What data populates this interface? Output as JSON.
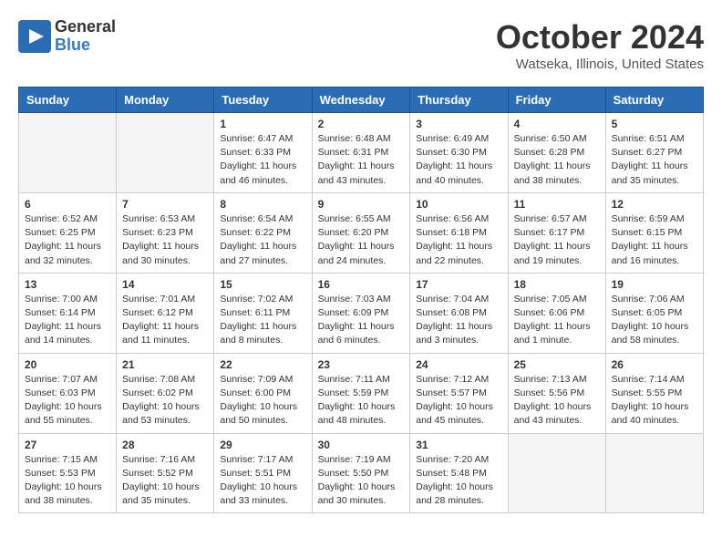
{
  "logo": {
    "general": "General",
    "blue": "Blue"
  },
  "title": "October 2024",
  "location": "Watseka, Illinois, United States",
  "days_of_week": [
    "Sunday",
    "Monday",
    "Tuesday",
    "Wednesday",
    "Thursday",
    "Friday",
    "Saturday"
  ],
  "weeks": [
    [
      {
        "day": "",
        "sunrise": "",
        "sunset": "",
        "daylight": "",
        "empty": true
      },
      {
        "day": "",
        "sunrise": "",
        "sunset": "",
        "daylight": "",
        "empty": true
      },
      {
        "day": "1",
        "sunrise": "Sunrise: 6:47 AM",
        "sunset": "Sunset: 6:33 PM",
        "daylight": "Daylight: 11 hours and 46 minutes."
      },
      {
        "day": "2",
        "sunrise": "Sunrise: 6:48 AM",
        "sunset": "Sunset: 6:31 PM",
        "daylight": "Daylight: 11 hours and 43 minutes."
      },
      {
        "day": "3",
        "sunrise": "Sunrise: 6:49 AM",
        "sunset": "Sunset: 6:30 PM",
        "daylight": "Daylight: 11 hours and 40 minutes."
      },
      {
        "day": "4",
        "sunrise": "Sunrise: 6:50 AM",
        "sunset": "Sunset: 6:28 PM",
        "daylight": "Daylight: 11 hours and 38 minutes."
      },
      {
        "day": "5",
        "sunrise": "Sunrise: 6:51 AM",
        "sunset": "Sunset: 6:27 PM",
        "daylight": "Daylight: 11 hours and 35 minutes."
      }
    ],
    [
      {
        "day": "6",
        "sunrise": "Sunrise: 6:52 AM",
        "sunset": "Sunset: 6:25 PM",
        "daylight": "Daylight: 11 hours and 32 minutes."
      },
      {
        "day": "7",
        "sunrise": "Sunrise: 6:53 AM",
        "sunset": "Sunset: 6:23 PM",
        "daylight": "Daylight: 11 hours and 30 minutes."
      },
      {
        "day": "8",
        "sunrise": "Sunrise: 6:54 AM",
        "sunset": "Sunset: 6:22 PM",
        "daylight": "Daylight: 11 hours and 27 minutes."
      },
      {
        "day": "9",
        "sunrise": "Sunrise: 6:55 AM",
        "sunset": "Sunset: 6:20 PM",
        "daylight": "Daylight: 11 hours and 24 minutes."
      },
      {
        "day": "10",
        "sunrise": "Sunrise: 6:56 AM",
        "sunset": "Sunset: 6:18 PM",
        "daylight": "Daylight: 11 hours and 22 minutes."
      },
      {
        "day": "11",
        "sunrise": "Sunrise: 6:57 AM",
        "sunset": "Sunset: 6:17 PM",
        "daylight": "Daylight: 11 hours and 19 minutes."
      },
      {
        "day": "12",
        "sunrise": "Sunrise: 6:59 AM",
        "sunset": "Sunset: 6:15 PM",
        "daylight": "Daylight: 11 hours and 16 minutes."
      }
    ],
    [
      {
        "day": "13",
        "sunrise": "Sunrise: 7:00 AM",
        "sunset": "Sunset: 6:14 PM",
        "daylight": "Daylight: 11 hours and 14 minutes."
      },
      {
        "day": "14",
        "sunrise": "Sunrise: 7:01 AM",
        "sunset": "Sunset: 6:12 PM",
        "daylight": "Daylight: 11 hours and 11 minutes."
      },
      {
        "day": "15",
        "sunrise": "Sunrise: 7:02 AM",
        "sunset": "Sunset: 6:11 PM",
        "daylight": "Daylight: 11 hours and 8 minutes."
      },
      {
        "day": "16",
        "sunrise": "Sunrise: 7:03 AM",
        "sunset": "Sunset: 6:09 PM",
        "daylight": "Daylight: 11 hours and 6 minutes."
      },
      {
        "day": "17",
        "sunrise": "Sunrise: 7:04 AM",
        "sunset": "Sunset: 6:08 PM",
        "daylight": "Daylight: 11 hours and 3 minutes."
      },
      {
        "day": "18",
        "sunrise": "Sunrise: 7:05 AM",
        "sunset": "Sunset: 6:06 PM",
        "daylight": "Daylight: 11 hours and 1 minute."
      },
      {
        "day": "19",
        "sunrise": "Sunrise: 7:06 AM",
        "sunset": "Sunset: 6:05 PM",
        "daylight": "Daylight: 10 hours and 58 minutes."
      }
    ],
    [
      {
        "day": "20",
        "sunrise": "Sunrise: 7:07 AM",
        "sunset": "Sunset: 6:03 PM",
        "daylight": "Daylight: 10 hours and 55 minutes."
      },
      {
        "day": "21",
        "sunrise": "Sunrise: 7:08 AM",
        "sunset": "Sunset: 6:02 PM",
        "daylight": "Daylight: 10 hours and 53 minutes."
      },
      {
        "day": "22",
        "sunrise": "Sunrise: 7:09 AM",
        "sunset": "Sunset: 6:00 PM",
        "daylight": "Daylight: 10 hours and 50 minutes."
      },
      {
        "day": "23",
        "sunrise": "Sunrise: 7:11 AM",
        "sunset": "Sunset: 5:59 PM",
        "daylight": "Daylight: 10 hours and 48 minutes."
      },
      {
        "day": "24",
        "sunrise": "Sunrise: 7:12 AM",
        "sunset": "Sunset: 5:57 PM",
        "daylight": "Daylight: 10 hours and 45 minutes."
      },
      {
        "day": "25",
        "sunrise": "Sunrise: 7:13 AM",
        "sunset": "Sunset: 5:56 PM",
        "daylight": "Daylight: 10 hours and 43 minutes."
      },
      {
        "day": "26",
        "sunrise": "Sunrise: 7:14 AM",
        "sunset": "Sunset: 5:55 PM",
        "daylight": "Daylight: 10 hours and 40 minutes."
      }
    ],
    [
      {
        "day": "27",
        "sunrise": "Sunrise: 7:15 AM",
        "sunset": "Sunset: 5:53 PM",
        "daylight": "Daylight: 10 hours and 38 minutes."
      },
      {
        "day": "28",
        "sunrise": "Sunrise: 7:16 AM",
        "sunset": "Sunset: 5:52 PM",
        "daylight": "Daylight: 10 hours and 35 minutes."
      },
      {
        "day": "29",
        "sunrise": "Sunrise: 7:17 AM",
        "sunset": "Sunset: 5:51 PM",
        "daylight": "Daylight: 10 hours and 33 minutes."
      },
      {
        "day": "30",
        "sunrise": "Sunrise: 7:19 AM",
        "sunset": "Sunset: 5:50 PM",
        "daylight": "Daylight: 10 hours and 30 minutes."
      },
      {
        "day": "31",
        "sunrise": "Sunrise: 7:20 AM",
        "sunset": "Sunset: 5:48 PM",
        "daylight": "Daylight: 10 hours and 28 minutes."
      },
      {
        "day": "",
        "sunrise": "",
        "sunset": "",
        "daylight": "",
        "empty": true
      },
      {
        "day": "",
        "sunrise": "",
        "sunset": "",
        "daylight": "",
        "empty": true
      }
    ]
  ]
}
